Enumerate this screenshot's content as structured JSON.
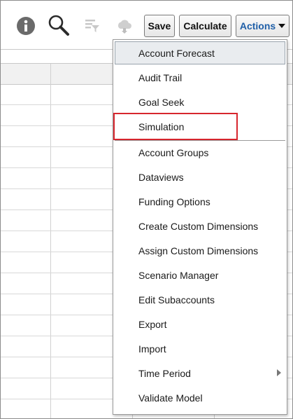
{
  "toolbar": {
    "icons": [
      {
        "name": "info-icon",
        "enabled": true
      },
      {
        "name": "search-icon",
        "enabled": true
      },
      {
        "name": "filter-icon",
        "enabled": false
      },
      {
        "name": "cloud-icon",
        "enabled": false
      }
    ],
    "save_label": "Save",
    "calculate_label": "Calculate",
    "actions_label": "Actions"
  },
  "menu": {
    "items": [
      {
        "label": "Account Forecast",
        "hovered": true
      },
      {
        "label": "Audit Trail"
      },
      {
        "label": "Goal Seek"
      },
      {
        "label": "Simulation",
        "annotated": true
      },
      {
        "label": "Account Groups"
      },
      {
        "label": "Dataviews"
      },
      {
        "label": "Funding Options"
      },
      {
        "label": "Create Custom Dimensions"
      },
      {
        "label": "Assign Custom Dimensions"
      },
      {
        "label": "Scenario Manager"
      },
      {
        "label": "Edit Subaccounts"
      },
      {
        "label": "Export"
      },
      {
        "label": "Import"
      },
      {
        "label": "Time Period",
        "has_submenu": true
      },
      {
        "label": "Validate Model"
      }
    ]
  },
  "colors": {
    "accent": "#1f5fa8",
    "annotation": "#d7262e",
    "hover_bg": "#e9ecef"
  }
}
